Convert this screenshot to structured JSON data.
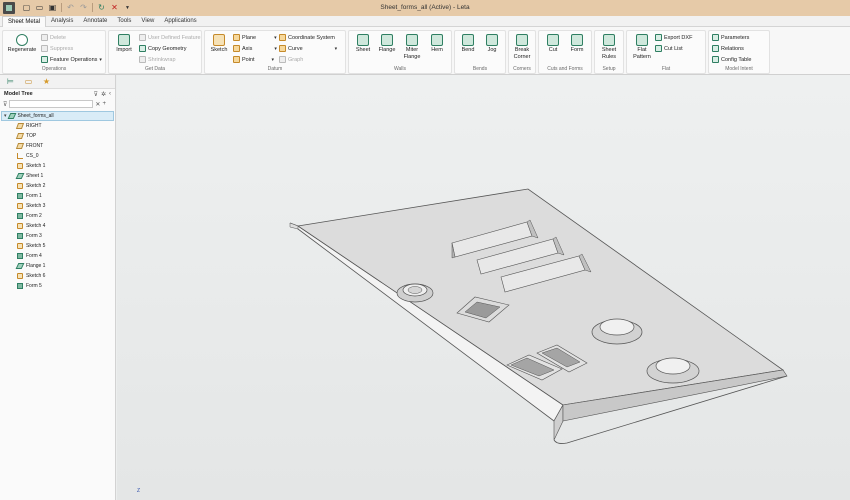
{
  "window": {
    "title": "Sheet_forms_all (Active) - Leta"
  },
  "ribbon_tabs": [
    {
      "label": "Sheet Metal",
      "active": true
    },
    {
      "label": "Analysis"
    },
    {
      "label": "Annotate"
    },
    {
      "label": "Tools"
    },
    {
      "label": "View"
    },
    {
      "label": "Applications"
    }
  ],
  "groups": {
    "operations": {
      "label": "Operations",
      "regenerate": "Regenerate",
      "delete": "Delete",
      "suppress": "Suppress",
      "feature_operations": "Feature Operations"
    },
    "get_data": {
      "label": "Get Data",
      "import": "Import",
      "user_defined_feature": "User Defined Feature",
      "copy_geometry": "Copy Geometry",
      "shrinkwrap": "Shrinkwrap"
    },
    "datum": {
      "label": "Datum",
      "sketch": "Sketch",
      "plane": "Plane",
      "axis": "Axis",
      "point": "Point",
      "coordinate_system": "Coordinate System",
      "curve": "Curve",
      "graph": "Graph"
    },
    "walls": {
      "label": "Walls",
      "sheet": "Sheet",
      "flange": "Flange",
      "miter_flange_1": "Miter",
      "miter_flange_2": "Flange",
      "hem": "Hem"
    },
    "bends": {
      "label": "Bends",
      "bend": "Bend",
      "jog": "Jog"
    },
    "corners": {
      "label": "Corners",
      "break_corner_1": "Break",
      "break_corner_2": "Corner"
    },
    "cuts_forms": {
      "label": "Cuts and Forms",
      "cut": "Cut",
      "form": "Form"
    },
    "setup": {
      "label": "Setup",
      "sheet_rules_1": "Sheet",
      "sheet_rules_2": "Rules"
    },
    "flat": {
      "label": "Flat",
      "flat_pattern_1": "Flat",
      "flat_pattern_2": "Pattern",
      "export_dxf": "Export DXF",
      "cut_list": "Cut List"
    },
    "model_intent": {
      "label": "Model Intent",
      "parameters": "Parameters",
      "relations": "Relations",
      "config_table": "Config Table"
    }
  },
  "left_panel": {
    "title": "Model Tree",
    "filter_placeholder": "",
    "root": "Sheet_forms_all",
    "items": [
      {
        "label": "RIGHT",
        "icon": "plane-icon"
      },
      {
        "label": "TOP",
        "icon": "plane-icon"
      },
      {
        "label": "FRONT",
        "icon": "plane-icon"
      },
      {
        "label": "CS_0",
        "icon": "coordinate-system-icon"
      },
      {
        "label": "Sketch 1",
        "icon": "sketch-icon"
      },
      {
        "label": "Sheet 1",
        "icon": "sheet-icon"
      },
      {
        "label": "Sketch 2",
        "icon": "sketch-icon"
      },
      {
        "label": "Form 1",
        "icon": "form-icon"
      },
      {
        "label": "Sketch 3",
        "icon": "sketch-icon"
      },
      {
        "label": "Form 2",
        "icon": "form-icon"
      },
      {
        "label": "Sketch 4",
        "icon": "sketch-icon"
      },
      {
        "label": "Form 3",
        "icon": "form-icon"
      },
      {
        "label": "Sketch 5",
        "icon": "sketch-icon"
      },
      {
        "label": "Form 4",
        "icon": "form-icon"
      },
      {
        "label": "Flange 1",
        "icon": "flange-icon"
      },
      {
        "label": "Sketch 6",
        "icon": "sketch-icon"
      },
      {
        "label": "Form 5",
        "icon": "form-icon"
      }
    ]
  },
  "viewport": {
    "triad_label": "Z"
  }
}
